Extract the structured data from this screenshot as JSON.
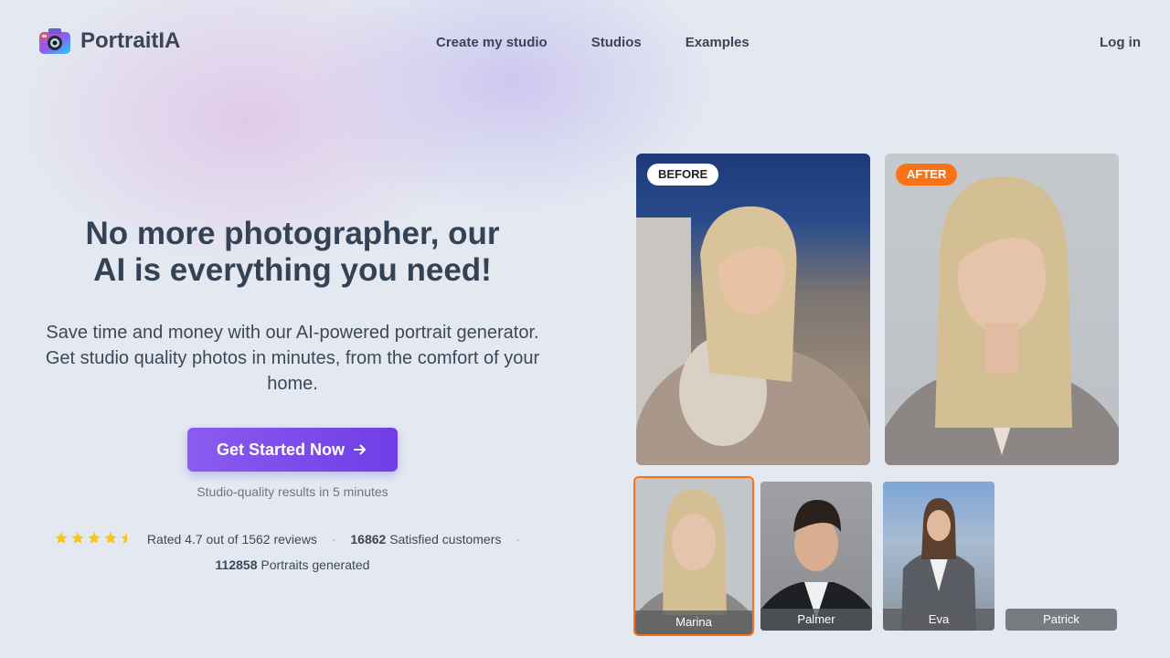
{
  "brand": {
    "name": "PortraitIA"
  },
  "nav": {
    "items": [
      "Create my studio",
      "Studios",
      "Examples"
    ],
    "login": "Log in"
  },
  "hero": {
    "headline": "No more photographer, our AI is everything you need!",
    "subtitle": "Save time and money with our AI-powered portrait generator. Get studio quality photos in minutes, from the comfort of your home.",
    "cta": "Get Started Now",
    "cta_icon": "arrow-right-icon",
    "cta_note": "Studio-quality results in 5 minutes"
  },
  "stats": {
    "rating": 4.7,
    "rating_text": "Rated 4.7 out of 1562 reviews",
    "customers_count": "16862",
    "customers_label": "Satisfied customers",
    "portraits_count": "112858",
    "portraits_label": "Portraits generated"
  },
  "comparison": {
    "before_label": "BEFORE",
    "after_label": "AFTER"
  },
  "thumbnails": [
    {
      "name": "Marina",
      "selected": true
    },
    {
      "name": "Palmer",
      "selected": false
    },
    {
      "name": "Eva",
      "selected": false
    },
    {
      "name": "Patrick",
      "selected": false
    }
  ],
  "colors": {
    "accent": "#7c4dee",
    "orange": "#f97316",
    "text": "#344256",
    "star": "#f5c518"
  }
}
